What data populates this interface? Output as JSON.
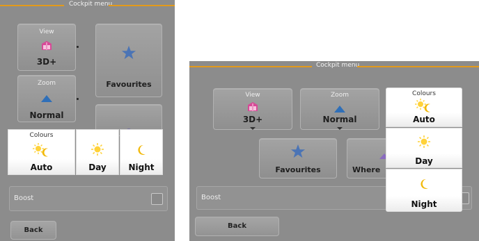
{
  "left": {
    "header_title": "Cockpit menu",
    "view": {
      "label": "View",
      "value": "3D+"
    },
    "zoom": {
      "label": "Zoom",
      "value": "Normal"
    },
    "favourites": {
      "label": "Favourites"
    },
    "colours": {
      "label": "Colours",
      "options": [
        "Auto",
        "Day",
        "Night"
      ]
    },
    "boost": {
      "label": "Boost"
    },
    "back": {
      "label": "Back"
    }
  },
  "right": {
    "header_title": "Cockpit menu",
    "view": {
      "label": "View",
      "value": "3D+"
    },
    "zoom": {
      "label": "Zoom",
      "value": "Normal"
    },
    "colours": {
      "label": "Colours",
      "value": "Auto",
      "options": [
        "Day",
        "Night"
      ]
    },
    "favourites": {
      "label": "Favourites"
    },
    "where": {
      "label": "Where"
    },
    "boost": {
      "label": "Boost"
    },
    "back": {
      "label": "Back"
    }
  },
  "colors": {
    "accent_line": "#e39a1b",
    "screen_bg": "#8c8c8c",
    "sun": "#ffd23a",
    "moon": "#f2b90a",
    "star": "#4b74b5",
    "zoom_arrow": "#2f6fb8",
    "view_icon": "#d64a97"
  },
  "icons": [
    "view-3d-icon",
    "zoom-arrow-icon",
    "star-icon",
    "sun-icon",
    "moon-icon",
    "sun-moon-icon",
    "dropdown-caret-icon"
  ]
}
